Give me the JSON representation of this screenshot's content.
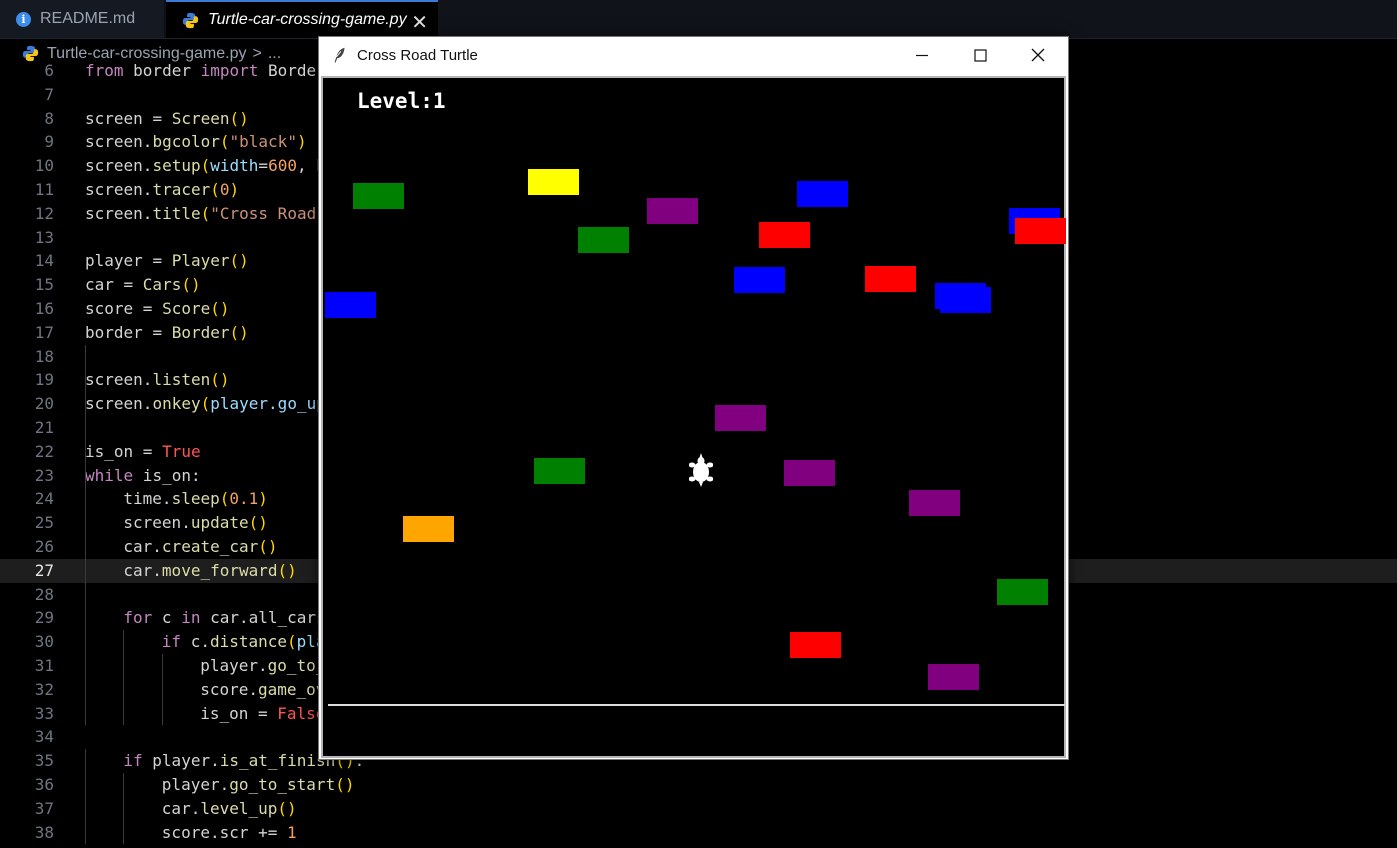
{
  "tabs": [
    {
      "label": "README.md",
      "icon": "info-icon"
    },
    {
      "label": "Turtle-car-crossing-game.py",
      "icon": "python-icon"
    }
  ],
  "breadcrumb": {
    "file": "Turtle-car-crossing-game.py",
    "sep": ">",
    "more": "..."
  },
  "code": {
    "current_line": 27,
    "lines": [
      {
        "n": "6",
        "tokens": [
          [
            "kw2",
            "from"
          ],
          [
            "op",
            " border "
          ],
          [
            "kw2",
            "import"
          ],
          [
            "op",
            " Border"
          ]
        ]
      },
      {
        "n": "7",
        "tokens": []
      },
      {
        "n": "8",
        "tokens": [
          [
            "op",
            "screen "
          ],
          [
            "op",
            "= "
          ],
          [
            "fn",
            "Screen"
          ],
          [
            "par",
            "()"
          ]
        ]
      },
      {
        "n": "9",
        "tokens": [
          [
            "op",
            "screen."
          ],
          [
            "fn",
            "bgcolor"
          ],
          [
            "par",
            "("
          ],
          [
            "str",
            "\"black\""
          ],
          [
            "par",
            ")"
          ]
        ]
      },
      {
        "n": "10",
        "tokens": [
          [
            "op",
            "screen."
          ],
          [
            "fn",
            "setup"
          ],
          [
            "par",
            "("
          ],
          [
            "var",
            "width"
          ],
          [
            "op",
            "="
          ],
          [
            "num",
            "600"
          ],
          [
            "op",
            ", h"
          ]
        ]
      },
      {
        "n": "11",
        "tokens": [
          [
            "op",
            "screen."
          ],
          [
            "fn",
            "tracer"
          ],
          [
            "par",
            "("
          ],
          [
            "num",
            "0"
          ],
          [
            "par",
            ")"
          ]
        ]
      },
      {
        "n": "12",
        "tokens": [
          [
            "op",
            "screen."
          ],
          [
            "fn",
            "title"
          ],
          [
            "par",
            "("
          ],
          [
            "str",
            "\"Cross Road"
          ]
        ]
      },
      {
        "n": "13",
        "tokens": []
      },
      {
        "n": "14",
        "tokens": [
          [
            "op",
            "player "
          ],
          [
            "op",
            "= "
          ],
          [
            "fn",
            "Player"
          ],
          [
            "par",
            "()"
          ]
        ]
      },
      {
        "n": "15",
        "tokens": [
          [
            "op",
            "car "
          ],
          [
            "op",
            "= "
          ],
          [
            "fn",
            "Cars"
          ],
          [
            "par",
            "()"
          ]
        ]
      },
      {
        "n": "16",
        "tokens": [
          [
            "op",
            "score "
          ],
          [
            "op",
            "= "
          ],
          [
            "fn",
            "Score"
          ],
          [
            "par",
            "()"
          ]
        ]
      },
      {
        "n": "17",
        "tokens": [
          [
            "op",
            "border "
          ],
          [
            "op",
            "= "
          ],
          [
            "fn",
            "Border"
          ],
          [
            "par",
            "()"
          ]
        ]
      },
      {
        "n": "18",
        "tokens": []
      },
      {
        "n": "19",
        "tokens": [
          [
            "op",
            "screen."
          ],
          [
            "fn",
            "listen"
          ],
          [
            "par",
            "()"
          ]
        ]
      },
      {
        "n": "20",
        "tokens": [
          [
            "op",
            "screen."
          ],
          [
            "fn",
            "onkey"
          ],
          [
            "par",
            "("
          ],
          [
            "var",
            "player.go_up"
          ]
        ]
      },
      {
        "n": "21",
        "tokens": []
      },
      {
        "n": "22",
        "tokens": [
          [
            "op",
            "is_on "
          ],
          [
            "op",
            "= "
          ],
          [
            "bool",
            "True"
          ]
        ]
      },
      {
        "n": "23",
        "tokens": [
          [
            "kw2",
            "while"
          ],
          [
            "op",
            " is_on:"
          ]
        ]
      },
      {
        "n": "24",
        "indent": 1,
        "tokens": [
          [
            "op",
            "time."
          ],
          [
            "fn",
            "sleep"
          ],
          [
            "par",
            "("
          ],
          [
            "num",
            "0.1"
          ],
          [
            "par",
            ")"
          ]
        ]
      },
      {
        "n": "25",
        "indent": 1,
        "tokens": [
          [
            "op",
            "screen."
          ],
          [
            "fn",
            "update"
          ],
          [
            "par",
            "()"
          ]
        ]
      },
      {
        "n": "26",
        "indent": 1,
        "tokens": [
          [
            "op",
            "car."
          ],
          [
            "fn",
            "create_car"
          ],
          [
            "par",
            "()"
          ]
        ]
      },
      {
        "n": "27",
        "indent": 1,
        "tokens": [
          [
            "op",
            "car."
          ],
          [
            "fn",
            "move_forward"
          ],
          [
            "par",
            "()"
          ]
        ]
      },
      {
        "n": "28",
        "tokens": []
      },
      {
        "n": "29",
        "indent": 1,
        "tokens": [
          [
            "kw2",
            "for"
          ],
          [
            "op",
            " c "
          ],
          [
            "kw2",
            "in"
          ],
          [
            "op",
            " car.all_cars"
          ]
        ]
      },
      {
        "n": "30",
        "indent": 2,
        "tokens": [
          [
            "kw2",
            "if"
          ],
          [
            "op",
            " c."
          ],
          [
            "fn",
            "distance"
          ],
          [
            "par",
            "("
          ],
          [
            "var",
            "play"
          ]
        ]
      },
      {
        "n": "31",
        "indent": 3,
        "tokens": [
          [
            "op",
            "player."
          ],
          [
            "fn",
            "go_to_"
          ]
        ]
      },
      {
        "n": "32",
        "indent": 3,
        "tokens": [
          [
            "op",
            "score."
          ],
          [
            "fn",
            "game_ov"
          ]
        ]
      },
      {
        "n": "33",
        "indent": 3,
        "tokens": [
          [
            "op",
            "is_on "
          ],
          [
            "op",
            "= "
          ],
          [
            "bool",
            "False"
          ]
        ]
      },
      {
        "n": "34",
        "tokens": []
      },
      {
        "n": "35",
        "indent": 1,
        "tokens": [
          [
            "kw2",
            "if"
          ],
          [
            "op",
            " player."
          ],
          [
            "fn",
            "is_at_finish"
          ],
          [
            "par",
            "()"
          ],
          [
            "op",
            ":"
          ]
        ]
      },
      {
        "n": "36",
        "indent": 2,
        "tokens": [
          [
            "op",
            "player."
          ],
          [
            "fn",
            "go_to_start"
          ],
          [
            "par",
            "()"
          ]
        ]
      },
      {
        "n": "37",
        "indent": 2,
        "tokens": [
          [
            "op",
            "car."
          ],
          [
            "fn",
            "level_up"
          ],
          [
            "par",
            "()"
          ]
        ]
      },
      {
        "n": "38",
        "indent": 2,
        "tokens": [
          [
            "op",
            "score.scr "
          ],
          [
            "op",
            "+= "
          ],
          [
            "num",
            "1"
          ]
        ]
      }
    ]
  },
  "window": {
    "title": "Cross Road Turtle",
    "level_text": "Level:1",
    "cars": [
      {
        "color": "#008000"
      },
      {
        "color": "#ffff00"
      },
      {
        "color": "#800080"
      },
      {
        "color": "#0000ff"
      },
      {
        "color": "#008000"
      },
      {
        "color": "#ff0000"
      },
      {
        "color": "#0000ff"
      },
      {
        "color": "#ff0000"
      },
      {
        "color": "#0000ff"
      },
      {
        "color": "#ff0000"
      },
      {
        "color": "#0000ff"
      },
      {
        "color": "#0000ff"
      },
      {
        "color": "#0000ff"
      },
      {
        "color": "#800080"
      },
      {
        "color": "#008000"
      },
      {
        "color": "#800080"
      },
      {
        "color": "#800080"
      },
      {
        "color": "#ffa500"
      },
      {
        "color": "#008000"
      },
      {
        "color": "#ff0000"
      },
      {
        "color": "#800080"
      }
    ]
  }
}
